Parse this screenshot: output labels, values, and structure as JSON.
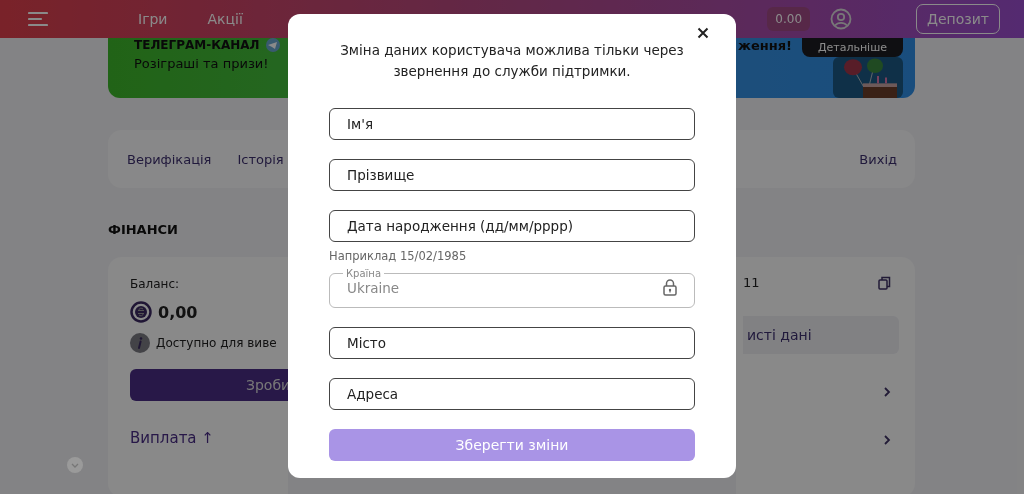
{
  "header": {
    "nav": [
      "Ігри",
      "Акції"
    ],
    "balance": "0.00",
    "deposit_button": "Депозит"
  },
  "banner": {
    "title": "ТЕЛЕГРАМ-КАНАЛ",
    "subtitle": "Розіграші та призи!",
    "right_title": "ження!",
    "button": "Детальніше"
  },
  "profile_tabs": [
    "Верифікація",
    "Історія"
  ],
  "logout": "Вихід",
  "finance": {
    "heading": "ФІНАНСИ",
    "balance_label": "Баланс:",
    "balance": "0,00",
    "available_text": "Доступно для виве",
    "action_button": "Зроби",
    "payout_link": "Виплата ↑"
  },
  "right_card": {
    "number": "11",
    "data_button": "исті дані"
  },
  "modal": {
    "notice": "Зміна даних користувача можлива тільки через звернення до служби підтримки.",
    "fields": [
      {
        "kind": "text",
        "placeholder": "Ім'я"
      },
      {
        "kind": "text",
        "placeholder": "Прізвище"
      },
      {
        "kind": "text",
        "placeholder": "Дата народження (дд/мм/рррр)",
        "hint": "Наприклад 15/02/1985"
      },
      {
        "kind": "locked",
        "label": "Країна",
        "value": "Ukraine"
      },
      {
        "kind": "text",
        "placeholder": "Місто"
      },
      {
        "kind": "text",
        "placeholder": "Адреса"
      }
    ],
    "save_button": {
      "label": "Зберегти зміни",
      "disabled": true
    }
  }
}
